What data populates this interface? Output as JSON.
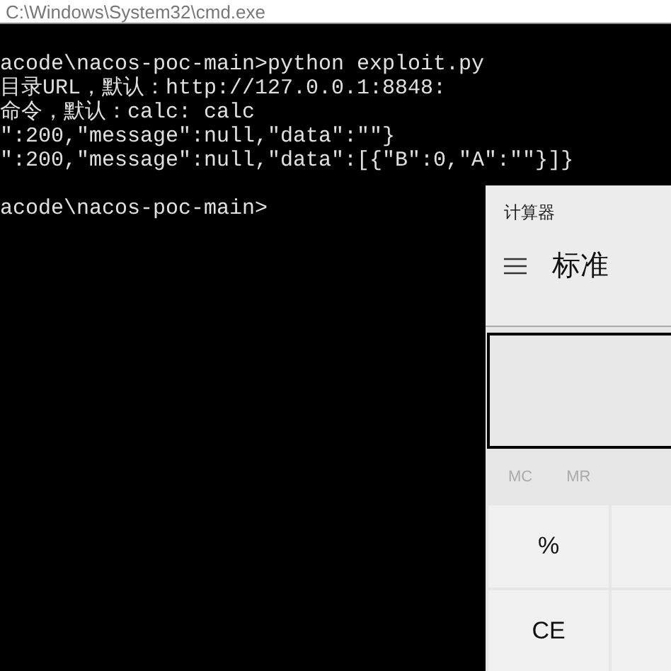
{
  "console_window": {
    "title": "C:\\Windows\\System32\\cmd.exe",
    "lines": [
      {
        "kind": "text",
        "text": "acode\\nacos-poc-main>python exploit.py"
      },
      {
        "kind": "text",
        "text": "目录URL，默认：http://127.0.0.1:8848:"
      },
      {
        "kind": "text",
        "text": "命令，默认：calc: calc"
      },
      {
        "kind": "text",
        "text": "\":200,\"message\":null,\"data\":\"\"}"
      },
      {
        "kind": "text",
        "text": "\":200,\"message\":null,\"data\":[{\"B\":0,\"A\":\"\"}]}"
      },
      {
        "kind": "blank"
      },
      {
        "kind": "text",
        "text": "acode\\nacos-poc-main>"
      }
    ]
  },
  "calculator": {
    "title": "计算器",
    "mode": "标准",
    "memory_buttons": [
      {
        "label": "MC",
        "disabled": true
      },
      {
        "label": "MR",
        "disabled": true
      }
    ],
    "keys": [
      {
        "kind": "key",
        "label": "%"
      },
      {
        "kind": "cut_off"
      },
      {
        "kind": "key",
        "label": "CE"
      },
      {
        "kind": "cut_off"
      }
    ]
  }
}
